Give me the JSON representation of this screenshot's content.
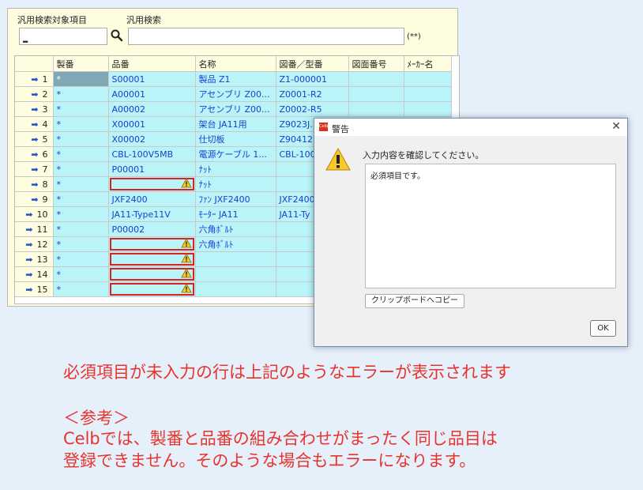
{
  "search": {
    "target_label": "汎用検索対象項目",
    "query_label": "汎用検索",
    "target_value": "",
    "query_value": "",
    "hint": "(**)"
  },
  "grid": {
    "columns": [
      "製番",
      "品番",
      "名称",
      "図番／型番",
      "図面番号",
      "ﾒｰｶｰ名"
    ],
    "rows": [
      {
        "no": "1",
        "seiban": "*",
        "hinban": "S00001",
        "name": "製品 Z1",
        "zuban": "Z1-000001"
      },
      {
        "no": "2",
        "seiban": "*",
        "hinban": "A00001",
        "name": "アセンブリ Z00...",
        "zuban": "Z0001-R2"
      },
      {
        "no": "3",
        "seiban": "*",
        "hinban": "A00002",
        "name": "アセンブリ Z00...",
        "zuban": "Z0002-R5"
      },
      {
        "no": "4",
        "seiban": "*",
        "hinban": "X00001",
        "name": "架台 JA11用",
        "zuban": "Z9023J..."
      },
      {
        "no": "5",
        "seiban": "*",
        "hinban": "X00002",
        "name": "仕切板",
        "zuban": "Z90412..."
      },
      {
        "no": "6",
        "seiban": "*",
        "hinban": "CBL-100V5MB",
        "name": "電源ケーブル 1...",
        "zuban": "CBL-100"
      },
      {
        "no": "7",
        "seiban": "*",
        "hinban": "P00001",
        "name": "ﾅｯﾄ",
        "zuban": ""
      },
      {
        "no": "8",
        "seiban": "*",
        "hinban": "",
        "name": "ﾅｯﾄ",
        "zuban": ""
      },
      {
        "no": "9",
        "seiban": "*",
        "hinban": "JXF2400",
        "name": "ﾌｧﾝ JXF2400",
        "zuban": "JXF2400"
      },
      {
        "no": "10",
        "seiban": "*",
        "hinban": "JA11-Type11V",
        "name": "ﾓｰﾀｰ JA11",
        "zuban": "JA11-Ty"
      },
      {
        "no": "11",
        "seiban": "*",
        "hinban": "P00002",
        "name": "六角ﾎﾞﾙﾄ",
        "zuban": ""
      },
      {
        "no": "12",
        "seiban": "*",
        "hinban": "",
        "name": "六角ﾎﾞﾙﾄ",
        "zuban": ""
      },
      {
        "no": "13",
        "seiban": "*",
        "hinban": "",
        "name": "",
        "zuban": ""
      },
      {
        "no": "14",
        "seiban": "*",
        "hinban": "",
        "name": "",
        "zuban": ""
      },
      {
        "no": "15",
        "seiban": "*",
        "hinban": "",
        "name": "",
        "zuban": ""
      }
    ],
    "error_rows": [
      "8",
      "12",
      "13",
      "14",
      "15"
    ]
  },
  "dialog": {
    "logo": "Celb",
    "title": "警告",
    "close": "✕",
    "heading": "入力内容を確認してください。",
    "message": "必須項目です。",
    "copy_button": "クリップボードへコピー",
    "ok_button": "OK"
  },
  "note": {
    "line1": "必須項目が未入力の行は上記のようなエラーが表示されます",
    "line2": "＜参考＞",
    "line3": "Celbでは、製番と品番の組み合わせがまったく同じ品目は",
    "line4": "登録できません。そのような場合もエラーになります。"
  },
  "colors": {
    "row_bg": "#b8f4f8",
    "error_border": "#d92323",
    "note_text": "#e8332c",
    "header_bg": "#fffde0"
  }
}
